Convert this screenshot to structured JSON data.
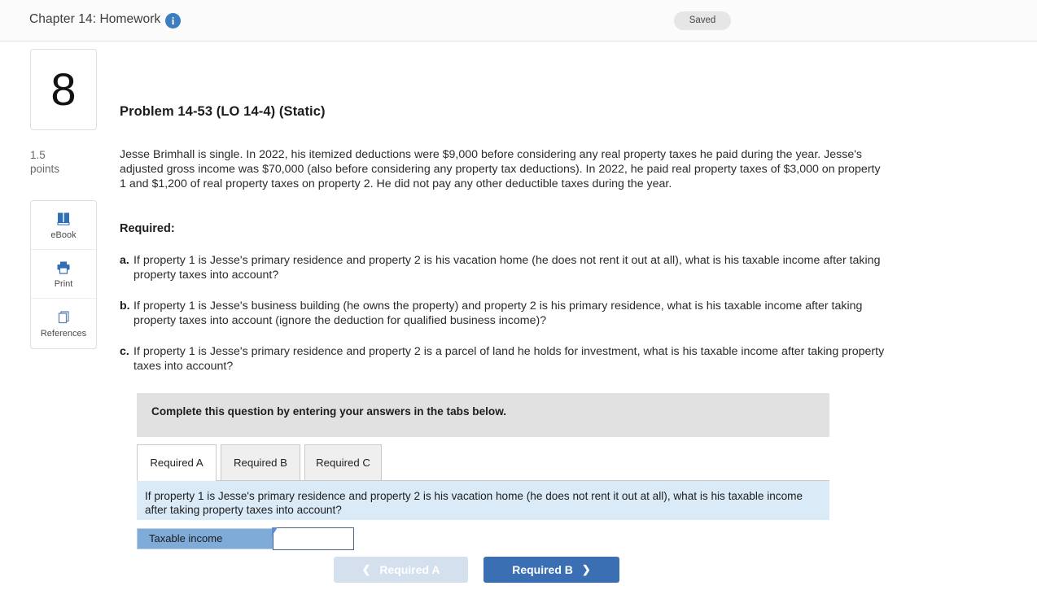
{
  "header": {
    "title": "Chapter 14: Homework",
    "info_icon": "info-icon",
    "status_badge": "Saved"
  },
  "sidebar": {
    "question_number": "8",
    "points_value": "1.5",
    "points_label": "points",
    "tools": [
      {
        "icon": "book-icon",
        "label": "eBook"
      },
      {
        "icon": "printer-icon",
        "label": "Print"
      },
      {
        "icon": "copy-pages-icon",
        "label": "References"
      }
    ]
  },
  "main": {
    "problem_title": "Problem 14-53 (LO 14-4) (Static)",
    "body_text": "Jesse Brimhall is single. In 2022, his itemized deductions were $9,000 before considering any real property taxes he paid during the year. Jesse's adjusted gross income was $70,000 (also before considering any property tax deductions). In 2022, he paid real property taxes of $3,000 on property 1 and $1,200 of real property taxes on property 2. He did not pay any other deductible taxes during the year.",
    "required_label": "Required:",
    "required_items": [
      {
        "marker": "a.",
        "text": "If property 1 is Jesse's primary residence and property 2 is his vacation home (he does not rent it out at all), what is his taxable income after taking property taxes into account?"
      },
      {
        "marker": "b.",
        "text": "If property 1 is Jesse's business building (he owns the property) and property 2 is his primary residence, what is his taxable income after taking property taxes into account (ignore the deduction for qualified business income)?"
      },
      {
        "marker": "c.",
        "text": "If property 1 is Jesse's primary residence and property 2 is a parcel of land he holds for investment, what is his taxable income after taking property taxes into account?"
      }
    ]
  },
  "answer_panel": {
    "instruction": "Complete this question by entering your answers in the tabs below.",
    "tabs": [
      {
        "label": "Required A",
        "active": true
      },
      {
        "label": "Required B",
        "active": false
      },
      {
        "label": "Required C",
        "active": false
      }
    ],
    "active_question": "If property 1 is Jesse's primary residence and property 2 is his vacation home (he does not rent it out at all), what is his taxable income after taking property taxes into account?",
    "answer_row": {
      "label": "Taxable income",
      "value": "",
      "placeholder": ""
    }
  },
  "footer": {
    "prev_label": "Required A",
    "prev_chevron": "chevron-left-icon",
    "next_label": "Required B",
    "next_chevron": "chevron-right-icon"
  },
  "colors": {
    "accent_blue": "#3a6fb4",
    "label_blue": "#7fabd8",
    "question_banner_blue": "#daeaf7",
    "instruction_gray": "#e1e1e1",
    "disabled_blue": "#d4e0ee"
  }
}
